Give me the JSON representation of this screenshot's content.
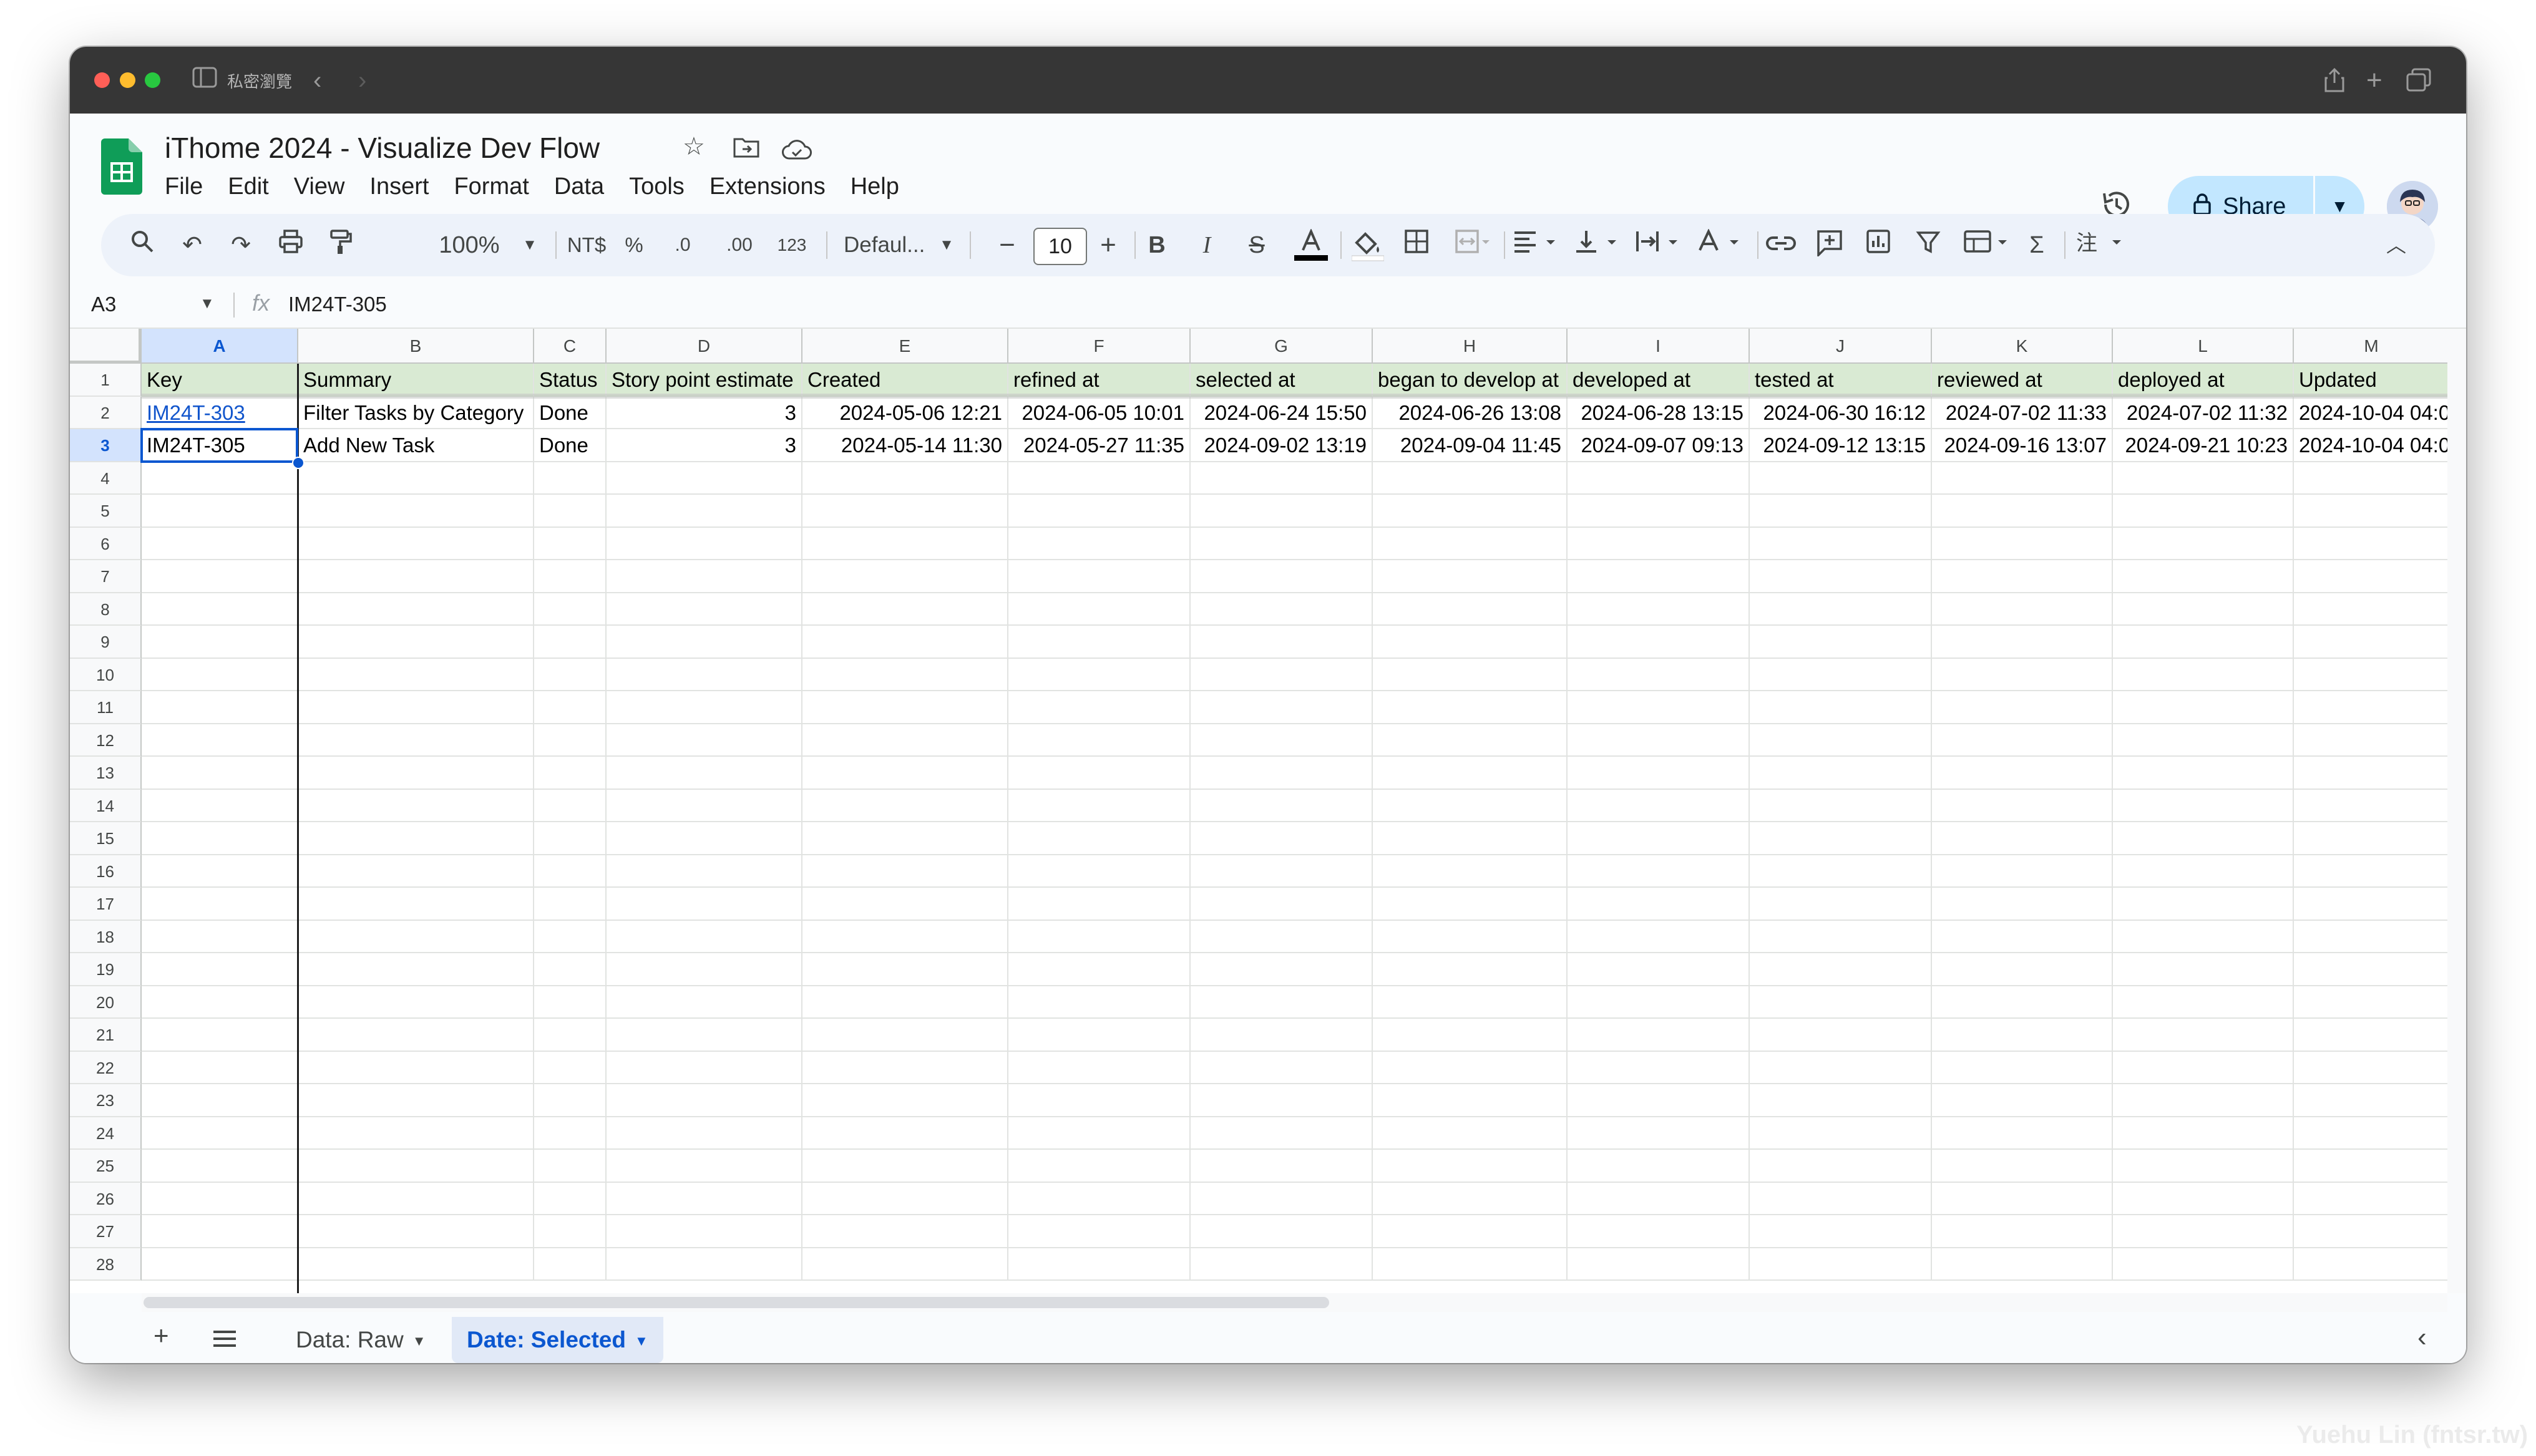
{
  "browser": {
    "label": "私密瀏覽",
    "icons": [
      "sidebar-icon",
      "back-icon",
      "forward-icon",
      "share-icon",
      "new-tab-icon",
      "tabs-overview-icon"
    ]
  },
  "doc": {
    "title": "iThome 2024 - Visualize Dev Flow",
    "menu": [
      "File",
      "Edit",
      "View",
      "Insert",
      "Format",
      "Data",
      "Tools",
      "Extensions",
      "Help"
    ],
    "share_label": "Share"
  },
  "toolbar": {
    "zoom": "100%",
    "currency": "NT$",
    "percent": "%",
    "dec_less": ".0",
    "dec_more": ".00",
    "format_123": "123",
    "font": "Defaul...",
    "font_size": "10"
  },
  "formula": {
    "cell_ref": "A3",
    "value": "IM24T-305"
  },
  "columns": [
    "A",
    "B",
    "C",
    "D",
    "E",
    "F",
    "G",
    "H",
    "I",
    "J",
    "K",
    "L",
    "M"
  ],
  "headers": [
    "Key",
    "Summary",
    "Status",
    "Story point estimate",
    "Created",
    "refined at",
    "selected at",
    "began to develop at",
    "developed at",
    "tested at",
    "reviewed at",
    "deployed at",
    "Updated"
  ],
  "rows": [
    [
      "IM24T-303",
      "Filter Tasks by Category",
      "Done",
      "3",
      "2024-05-06 12:21",
      "2024-06-05 10:01",
      "2024-06-24 15:50",
      "2024-06-26 13:08",
      "2024-06-28 13:15",
      "2024-06-30 16:12",
      "2024-07-02 11:33",
      "2024-07-02 11:32",
      "2024-10-04 04:0"
    ],
    [
      "IM24T-305",
      "Add New Task",
      "Done",
      "3",
      "2024-05-14 11:30",
      "2024-05-27 11:35",
      "2024-09-02 13:19",
      "2024-09-04 11:45",
      "2024-09-07 09:13",
      "2024-09-12 13:15",
      "2024-09-16 13:07",
      "2024-09-21 10:23",
      "2024-10-04 04:0"
    ]
  ],
  "row_numbers": [
    "1",
    "2",
    "3",
    "4",
    "5",
    "6",
    "7",
    "8",
    "9",
    "10",
    "11",
    "12",
    "13",
    "14",
    "15",
    "16",
    "17",
    "18",
    "19",
    "20",
    "21",
    "22",
    "23",
    "24",
    "25",
    "26",
    "27",
    "28"
  ],
  "sheets": [
    {
      "label": "Data: Raw",
      "active": false
    },
    {
      "label": "Date: Selected",
      "active": true
    }
  ],
  "selection": {
    "cell": "A3",
    "column": "A",
    "row": "3"
  },
  "colors": {
    "accent": "#0b57d0",
    "share_bg": "#c2e7ff",
    "header_fill": "#d9ead3",
    "link": "#1155cc"
  },
  "watermark": "Yuehu Lin (fntsr.tw)"
}
